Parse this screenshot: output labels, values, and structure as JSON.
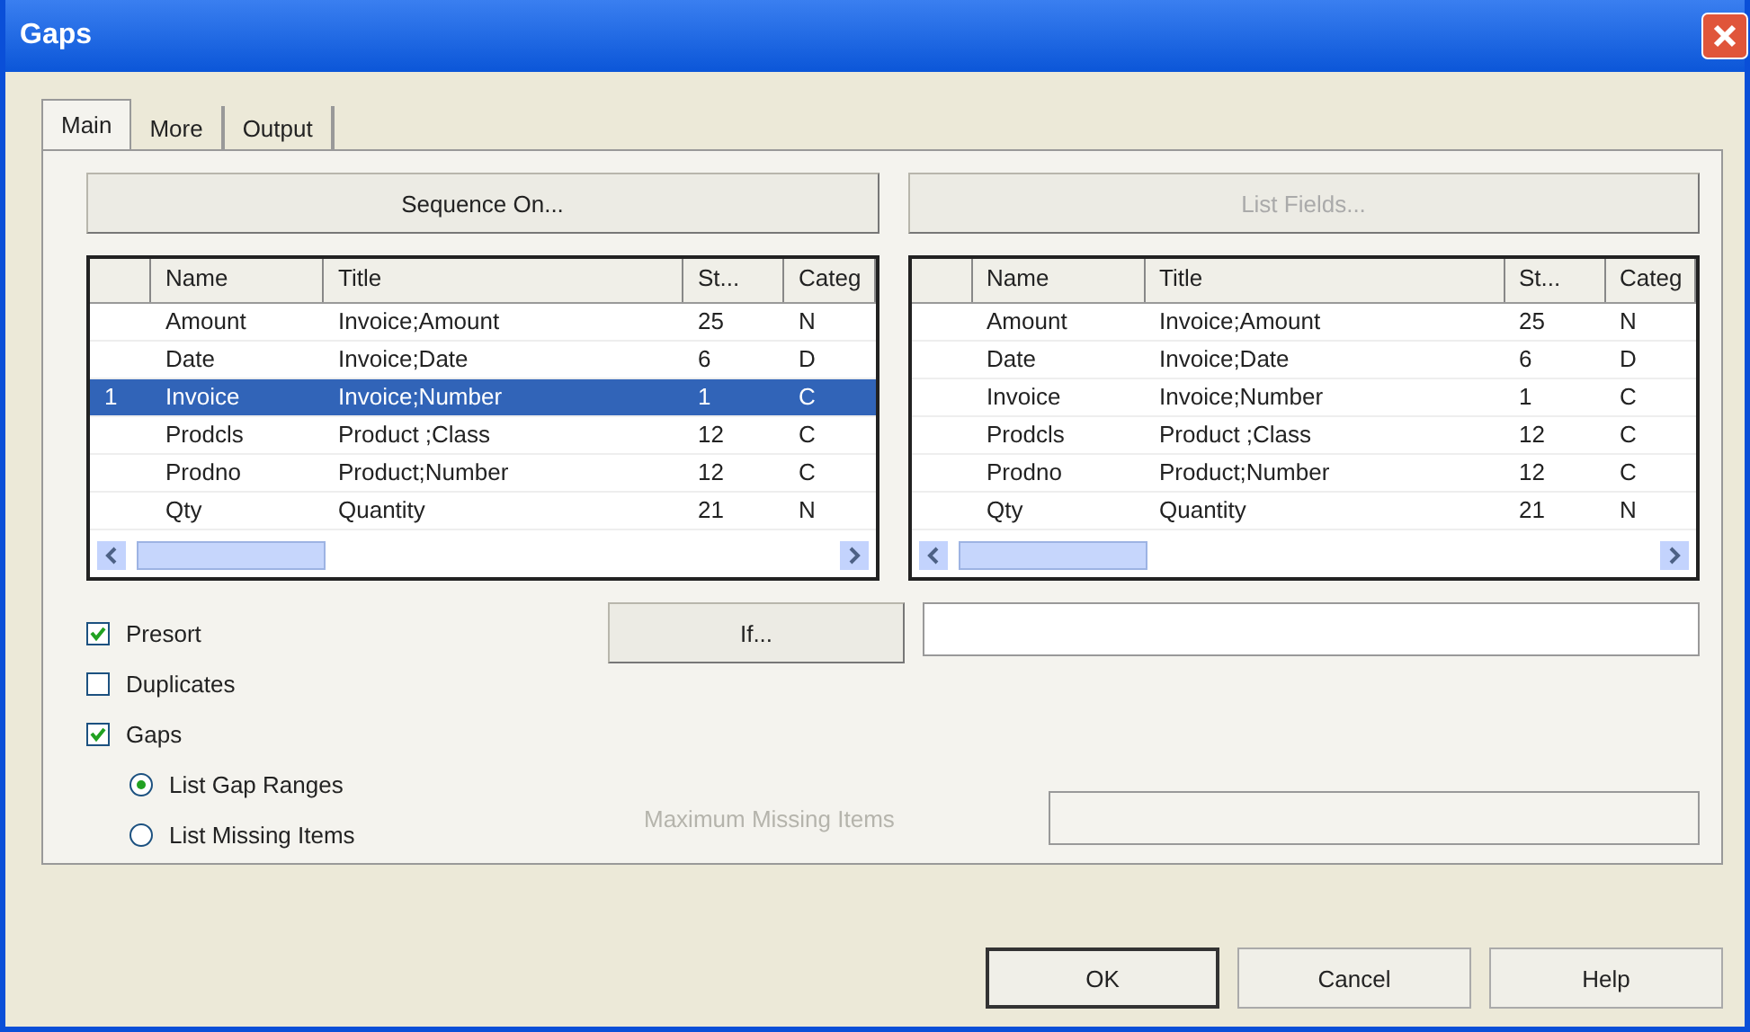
{
  "window": {
    "title": "Gaps"
  },
  "tabs": [
    {
      "label": "Main",
      "selected": true
    },
    {
      "label": "More",
      "selected": false
    },
    {
      "label": "Output",
      "selected": false
    }
  ],
  "sequence_button": {
    "label": "Sequence On...",
    "disabled": false
  },
  "list_fields_button": {
    "label": "List Fields...",
    "disabled": true
  },
  "tables": [
    {
      "columns": [
        "Name",
        "Title",
        "St...",
        "Categ"
      ],
      "rows": [
        {
          "marker": "",
          "cells": [
            "Amount",
            "Invoice;Amount",
            "25",
            "N"
          ],
          "selected": false
        },
        {
          "marker": "",
          "cells": [
            "Date",
            "Invoice;Date",
            "6",
            "D"
          ],
          "selected": false
        },
        {
          "marker": "1",
          "cells": [
            "Invoice",
            "Invoice;Number",
            "1",
            "C"
          ],
          "selected": true
        },
        {
          "marker": "",
          "cells": [
            "Prodcls",
            "Product ;Class",
            "12",
            "C"
          ],
          "selected": false
        },
        {
          "marker": "",
          "cells": [
            "Prodno",
            "Product;Number",
            "12",
            "C"
          ],
          "selected": false
        },
        {
          "marker": "",
          "cells": [
            "Qty",
            "Quantity",
            "21",
            "N"
          ],
          "selected": false
        }
      ]
    },
    {
      "columns": [
        "Name",
        "Title",
        "St...",
        "Categ"
      ],
      "rows": [
        {
          "marker": "",
          "cells": [
            "Amount",
            "Invoice;Amount",
            "25",
            "N"
          ],
          "selected": false
        },
        {
          "marker": "",
          "cells": [
            "Date",
            "Invoice;Date",
            "6",
            "D"
          ],
          "selected": false
        },
        {
          "marker": "",
          "cells": [
            "Invoice",
            "Invoice;Number",
            "1",
            "C"
          ],
          "selected": false
        },
        {
          "marker": "",
          "cells": [
            "Prodcls",
            "Product ;Class",
            "12",
            "C"
          ],
          "selected": false
        },
        {
          "marker": "",
          "cells": [
            "Prodno",
            "Product;Number",
            "12",
            "C"
          ],
          "selected": false
        },
        {
          "marker": "",
          "cells": [
            "Qty",
            "Quantity",
            "21",
            "N"
          ],
          "selected": false
        }
      ]
    }
  ],
  "checkboxes": [
    {
      "label": "Presort",
      "checked": true
    },
    {
      "label": "Duplicates",
      "checked": false
    },
    {
      "label": "Gaps",
      "checked": true
    }
  ],
  "if_button": {
    "label": "If..."
  },
  "radios": [
    {
      "label": "List Gap Ranges",
      "selected": true
    },
    {
      "label": "List Missing Items",
      "selected": false
    }
  ],
  "max_missing": {
    "label": "Maximum Missing Items",
    "disabled": true
  },
  "footer_buttons": [
    {
      "label": "OK",
      "default": true
    },
    {
      "label": "Cancel",
      "default": false
    },
    {
      "label": "Help",
      "default": false
    }
  ]
}
